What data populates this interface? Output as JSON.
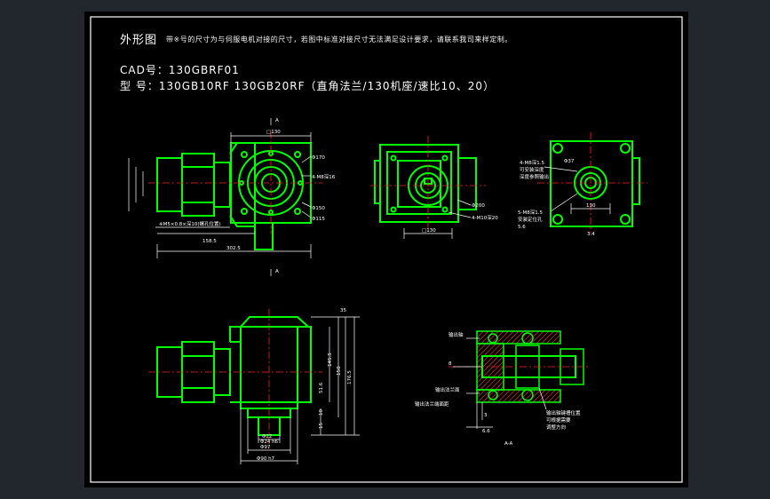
{
  "sheet": {
    "title": "外形图",
    "note": "带※号的尺寸为与伺服电机对接的尺寸，若图中标准对接尺寸无法满足设计要求，请联系我司来样定制。",
    "cad_label": "CAD号：",
    "cad_value": "130GBRF01",
    "model_label": "型 号：",
    "model_value": "130GB10RF  130GB20RF（直角法兰/130机座/速比10、20）"
  },
  "colors": {
    "background": "#000000",
    "frame": "#ffffff",
    "outline": "#00ff00",
    "hatch": "#ff3a3a",
    "centerline": "#ff2020",
    "dimension": "#ffffff",
    "callout": "#00ffff"
  },
  "dims": {
    "top_130": "□130",
    "dia_170": "Φ170",
    "holes_4_m8": "4-M8深16",
    "dia_150": "Φ150",
    "dia_115": "Φ115",
    "screw_note": "※M5×0.8×深10(螺孔位置)",
    "len_158": "158.5",
    "len_302": "302.5",
    "sec_a": "A",
    "front_130": "□130",
    "dia_200": "Φ200",
    "holes_4_m10": "4-M10深20",
    "dia_37": "Φ37",
    "key_4x5": "4-M8深1.5",
    "motor_note1": "可安装深度",
    "motor_note2": "深度参照输出",
    "m6": "5-M8深1.5",
    "m6b": "安装定位孔",
    "v56": "5.6",
    "v130": "130",
    "right_34": "3.4",
    "h_35": "35",
    "h_145": "145.5",
    "h_150": "150",
    "h_176": "176.5",
    "h_51": "51.6",
    "h_10": "10",
    "h_15": "15",
    "d_22": "Φ22",
    "d_24": "Φ24 h6",
    "d_97": "Φ97",
    "d_90": "Φ90 h7",
    "sec_l1": "输出轴",
    "sec_l2": "输出法兰面",
    "sec_l3": "输出法兰端面距",
    "sec_n1": "输出轴键槽位置",
    "sec_n2": "可根据需要",
    "sec_n3": "调整方向",
    "sec_8": "8",
    "sec_3": "3",
    "sec_66": "6.6",
    "sec_aa": "A-A"
  }
}
